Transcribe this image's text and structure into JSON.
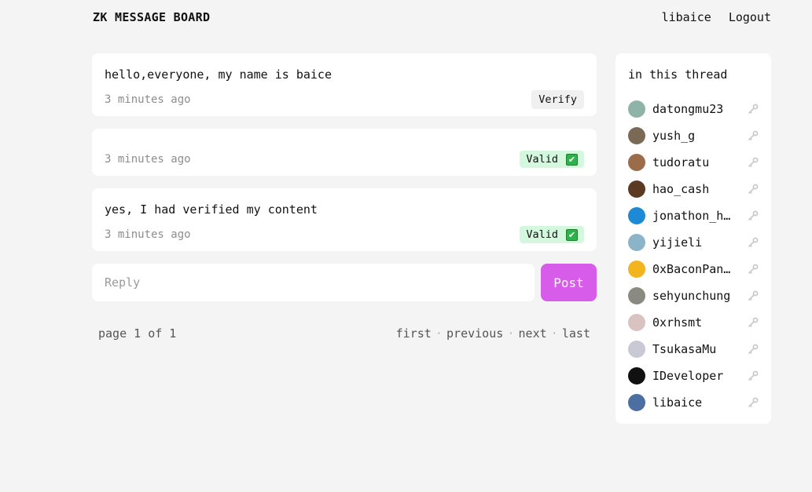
{
  "header": {
    "brand": "ZK MESSAGE BOARD",
    "user": "libaice",
    "logout": "Logout"
  },
  "posts": [
    {
      "text": "hello,everyone, my name is baice",
      "time": "3 minutes ago",
      "action": "Verify"
    },
    {
      "text": "",
      "time": "3 minutes ago",
      "status": "Valid",
      "status_icon": "✔"
    },
    {
      "text": "yes, I had verified my content",
      "time": "3 minutes ago",
      "status": "Valid",
      "status_icon": "✔"
    }
  ],
  "reply": {
    "placeholder": "Reply",
    "post_label": "Post"
  },
  "pager": {
    "status": "page 1 of 1",
    "first": "first",
    "previous": "previous",
    "next": "next",
    "last": "last",
    "separator": "·"
  },
  "sidebar": {
    "title": "in this thread",
    "users": [
      {
        "name": "datongmu23",
        "color": "#8fb3a8"
      },
      {
        "name": "yush_g",
        "color": "#7a6a55"
      },
      {
        "name": "tudoratu",
        "color": "#9a6c4a"
      },
      {
        "name": "hao_cash",
        "color": "#5a3a22"
      },
      {
        "name": "jonathon_h…",
        "color": "#1e8ad6"
      },
      {
        "name": "yijieli",
        "color": "#8cb4c8"
      },
      {
        "name": "0xBaconPan…",
        "color": "#f2b51e"
      },
      {
        "name": "sehyunchung",
        "color": "#8a8a80"
      },
      {
        "name": "0xrhsmt",
        "color": "#d9c2c2"
      },
      {
        "name": "TsukasaMu",
        "color": "#c9c9d6"
      },
      {
        "name": "IDeveloper",
        "color": "#111111"
      },
      {
        "name": "libaice",
        "color": "#4b6fa0"
      }
    ]
  }
}
